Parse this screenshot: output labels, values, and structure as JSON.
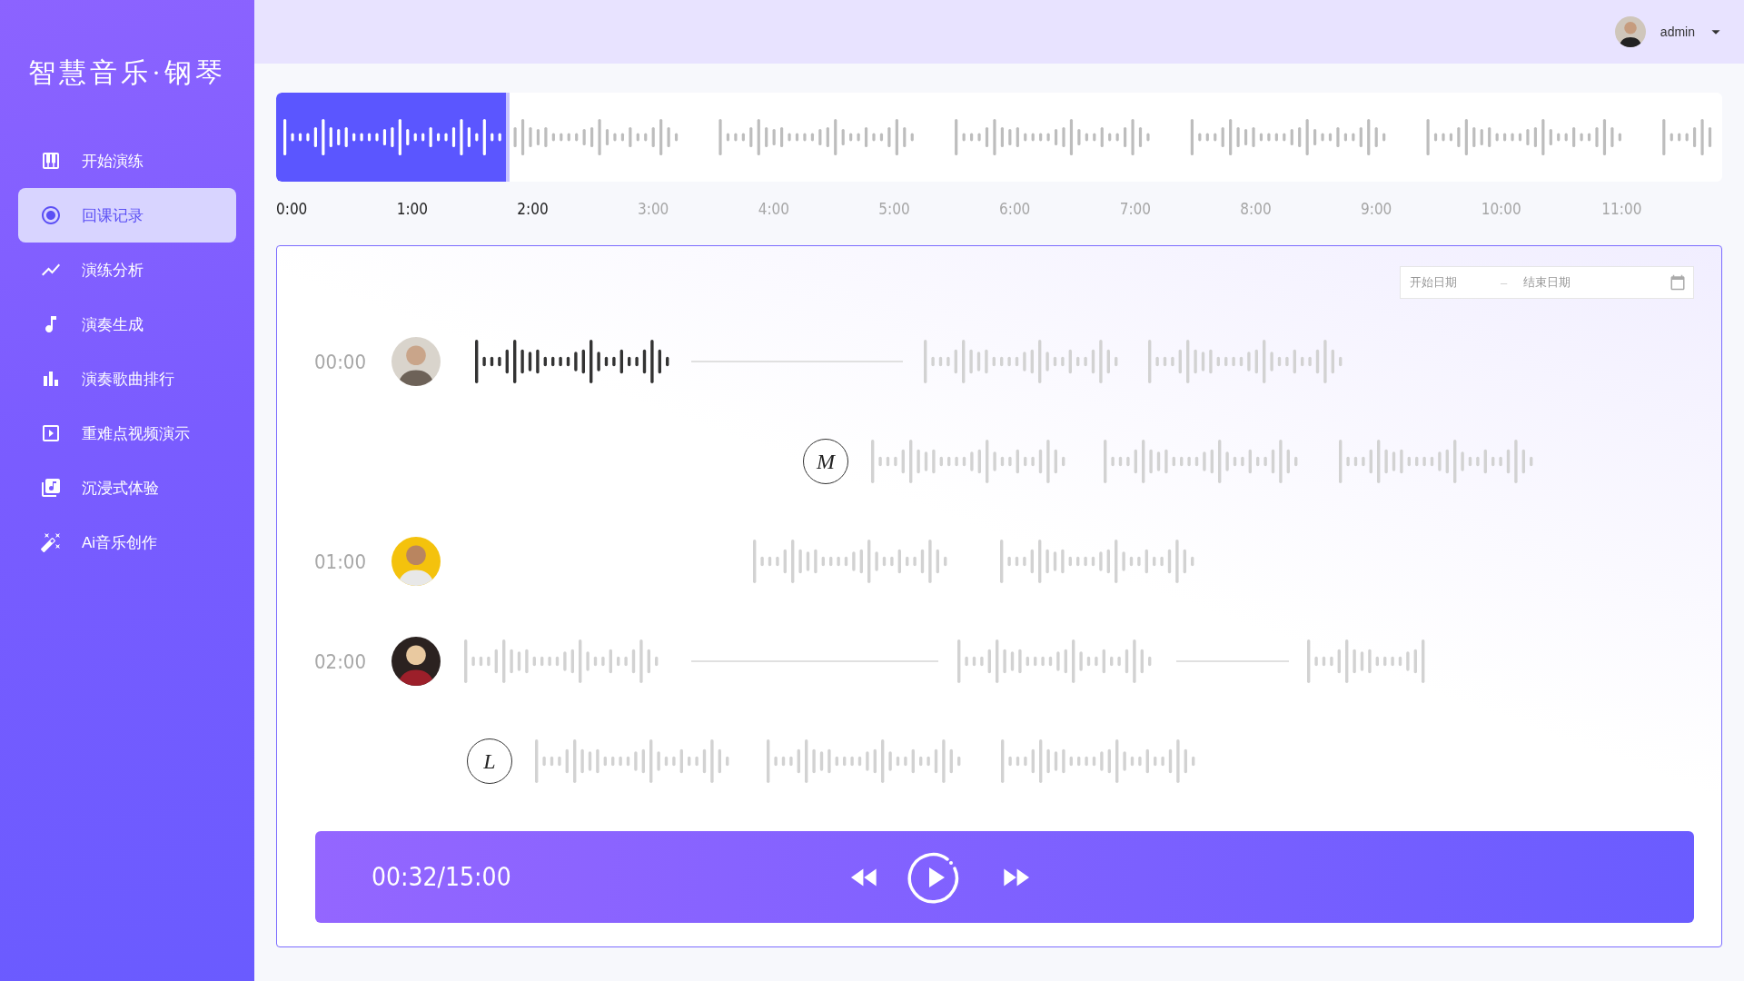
{
  "sidebar": {
    "logo": "智慧音乐·钢琴",
    "items": [
      {
        "label": "开始演练",
        "selected": false
      },
      {
        "label": "回课记录",
        "selected": true
      },
      {
        "label": "演练分析",
        "selected": false
      },
      {
        "label": "演奏生成",
        "selected": false
      },
      {
        "label": "演奏歌曲排行",
        "selected": false
      },
      {
        "label": "重难点视频演示",
        "selected": false
      },
      {
        "label": "沉浸式体验",
        "selected": false
      },
      {
        "label": "Ai音乐创作",
        "selected": false
      }
    ]
  },
  "header": {
    "user": "admin"
  },
  "overview": {
    "level": 0.16,
    "ticks": [
      {
        "label": "0:00",
        "played": true
      },
      {
        "label": "1:00",
        "played": true
      },
      {
        "label": "2:00",
        "played": true
      },
      {
        "label": "3:00",
        "played": false
      },
      {
        "label": "4:00",
        "played": false
      },
      {
        "label": "5:00",
        "played": false
      },
      {
        "label": "6:00",
        "played": false
      },
      {
        "label": "7:00",
        "played": false
      },
      {
        "label": "8:00",
        "played": false
      },
      {
        "label": "9:00",
        "played": false
      },
      {
        "label": "10:00",
        "played": false
      },
      {
        "label": "11:00",
        "played": false
      }
    ]
  },
  "panel": {
    "date_range": {
      "start_placeholder": "开始日期",
      "separator": "–",
      "end_placeholder": "结束日期"
    },
    "rows": [
      {
        "kind": "avatar",
        "time": "00:00",
        "segments": [
          {
            "kind": "wave",
            "active": true
          },
          {
            "kind": "line"
          },
          {
            "kind": "wave",
            "active": false
          },
          {
            "kind": "wave",
            "active": false
          }
        ]
      },
      {
        "kind": "badge",
        "badge": "M",
        "segments": [
          {
            "kind": "wave",
            "active": false
          },
          {
            "kind": "wave",
            "active": false
          },
          {
            "kind": "wave",
            "active": false
          }
        ]
      },
      {
        "kind": "avatar",
        "time": "01:00",
        "segments": [
          {
            "kind": "wave",
            "active": false
          },
          {
            "kind": "wave",
            "active": false
          }
        ]
      },
      {
        "kind": "avatar",
        "time": "02:00",
        "segments": [
          {
            "kind": "wave",
            "active": false
          },
          {
            "kind": "line"
          },
          {
            "kind": "wave",
            "active": false
          },
          {
            "kind": "line"
          },
          {
            "kind": "wave",
            "active": false
          }
        ]
      },
      {
        "kind": "badge",
        "badge": "L",
        "segments": [
          {
            "kind": "wave",
            "active": false
          },
          {
            "kind": "wave",
            "active": false
          },
          {
            "kind": "wave",
            "active": false
          }
        ]
      }
    ]
  },
  "player": {
    "time": "00:32/15:00"
  }
}
